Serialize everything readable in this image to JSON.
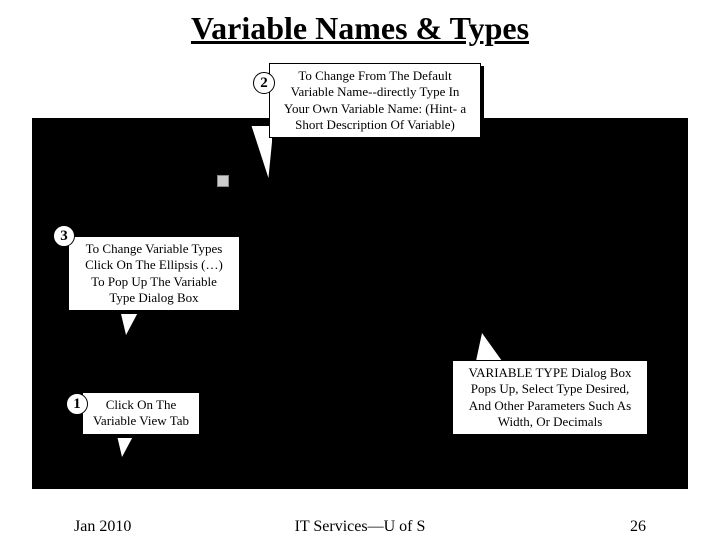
{
  "title": "Variable Names & Types",
  "callouts": {
    "c1": {
      "num": "1",
      "text": "Click On The Variable View Tab"
    },
    "c2": {
      "num": "2",
      "text": "To Change From The Default Variable Name--directly Type In Your Own Variable Name: (Hint- a Short Description Of Variable)"
    },
    "c3": {
      "num": "3",
      "text": "To Change Variable Types Click On The Ellipsis (…) To Pop Up The Variable Type Dialog Box"
    },
    "c4": {
      "text": "VARIABLE TYPE Dialog Box Pops Up, Select Type Desired, And Other Parameters Such As Width, Or Decimals"
    }
  },
  "footer": {
    "left": "Jan 2010",
    "center": "IT Services—U of S",
    "right": "26"
  }
}
